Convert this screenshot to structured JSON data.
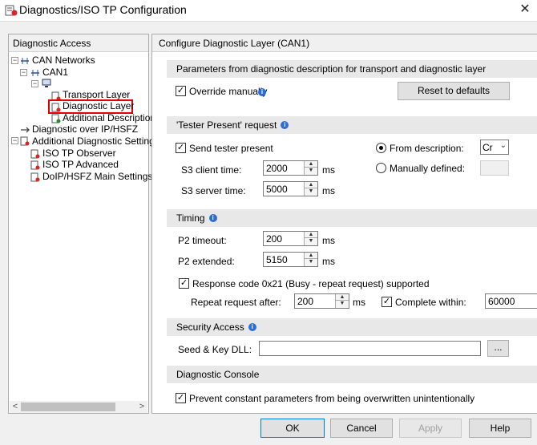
{
  "window": {
    "title": "Diagnostics/ISO TP Configuration",
    "close_glyph": "✕",
    "icon": "diagnostics-window-icon"
  },
  "left_pane": {
    "header": "Diagnostic Access",
    "tree": [
      {
        "label": "CAN Networks",
        "icon": "network-icon",
        "expanded": true
      },
      {
        "label": "CAN1",
        "icon": "network-icon",
        "expanded": true
      },
      {
        "label": "",
        "icon": "ecu-node-icon",
        "expanded": true
      },
      {
        "label": "Transport Layer",
        "icon": "layer-config-icon"
      },
      {
        "label": "Diagnostic Layer",
        "icon": "layer-config-icon",
        "selected": true
      },
      {
        "label": "Additional Descriptions",
        "icon": "layer-add-icon"
      },
      {
        "label": "Diagnostic over IP/HSFZ",
        "icon": "ip-connection-icon"
      },
      {
        "label": "Additional Diagnostic Settings",
        "icon": "settings-icon",
        "expanded": true
      },
      {
        "label": "ISO TP Observer",
        "icon": "layer-config-icon"
      },
      {
        "label": "ISO TP Advanced",
        "icon": "layer-config-icon"
      },
      {
        "label": "DoIP/HSFZ Main Settings",
        "icon": "layer-config-icon"
      }
    ],
    "scroll_left": "<",
    "scroll_right": ">"
  },
  "right_pane": {
    "header": "Configure Diagnostic Layer (CAN1)",
    "params_section": {
      "title": "Parameters from diagnostic description for transport and diagnostic layer",
      "override_label": "Override manually",
      "override_checked": true,
      "reset_button": "Reset to defaults"
    },
    "tester_section": {
      "title": "'Tester Present' request",
      "send_label": "Send tester present",
      "send_checked": true,
      "s3_client_label": "S3 client time:",
      "s3_client_value": "2000",
      "s3_server_label": "S3 server time:",
      "s3_server_value": "5000",
      "unit": "ms",
      "from_desc_label": "From description:",
      "from_desc_selected": true,
      "from_desc_combo": "Cr",
      "manual_label": "Manually defined:",
      "manual_selected": false
    },
    "timing_section": {
      "title": "Timing",
      "p2_timeout_label": "P2 timeout:",
      "p2_timeout_value": "200",
      "p2_extended_label": "P2 extended:",
      "p2_extended_value": "5150",
      "unit": "ms",
      "response_code_label": "Response code 0x21 (Busy - repeat request) supported",
      "response_code_checked": true,
      "repeat_label": "Repeat request after:",
      "repeat_value": "200",
      "complete_label": "Complete within:",
      "complete_checked": true,
      "complete_value": "60000"
    },
    "security_section": {
      "title": "Security Access",
      "dll_label": "Seed & Key DLL:",
      "dll_value": "",
      "browse_button": "..."
    },
    "console_section": {
      "title": "Diagnostic Console",
      "prevent_label": "Prevent constant parameters from being overwritten unintentionally",
      "prevent_checked": true
    }
  },
  "footer": {
    "ok": "OK",
    "cancel": "Cancel",
    "apply": "Apply",
    "help": "Help"
  },
  "colors": {
    "selection_border": "#e00000",
    "info_icon": "#2c6dd6",
    "section_background": "#e8e8e8"
  }
}
